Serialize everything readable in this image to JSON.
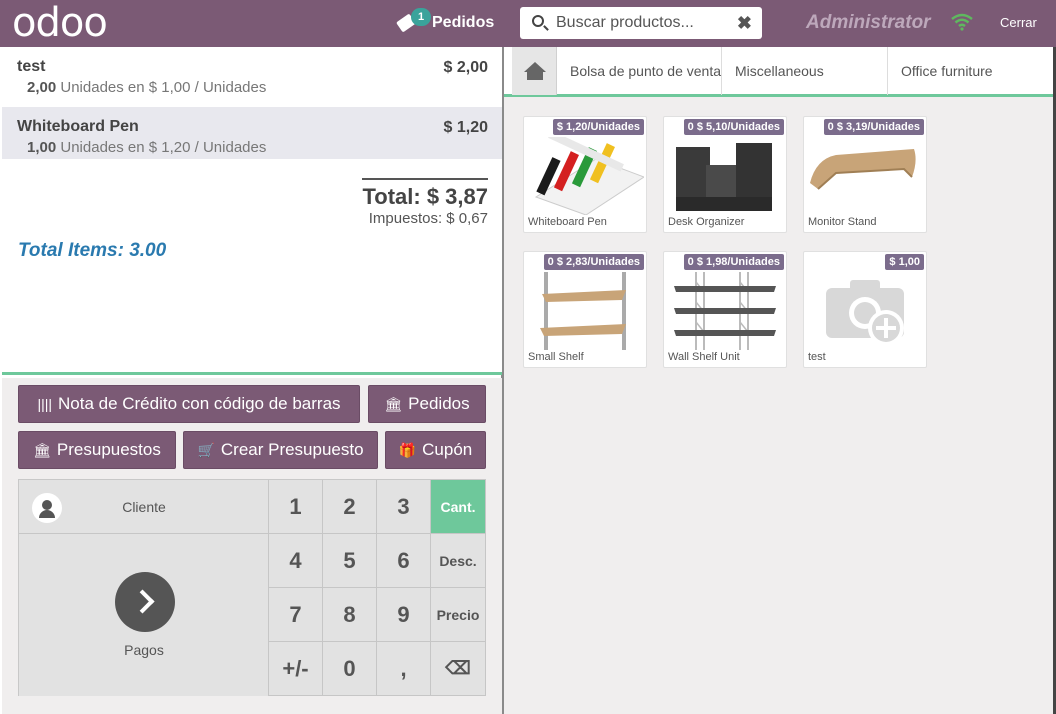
{
  "header": {
    "logo": "odoo",
    "orders_label": "Pedidos",
    "orders_count": "1",
    "search_placeholder": "Buscar productos...",
    "clear_icon": "✖",
    "user": "Administrator",
    "close_label": "Cerrar",
    "colors": {
      "brand": "#7b5a75",
      "badge": "#3aa39b",
      "wifi": "#5fb85f"
    }
  },
  "order": {
    "lines": [
      {
        "name": "test",
        "price": "$ 2,00",
        "qty": "2,00",
        "detail": "Unidades en $ 1,00 / Unidades"
      },
      {
        "name": "Whiteboard Pen",
        "price": "$ 1,20",
        "qty": "1,00",
        "detail": "Unidades en $ 1,20 / Unidades"
      }
    ],
    "total": "Total: $ 3,87",
    "taxes": "Impuestos: $ 0,67",
    "total_items": "Total Items: 3.00"
  },
  "actions": {
    "credit_note": "Nota de Crédito con código de barras",
    "orders": "Pedidos",
    "quotations": "Presupuestos",
    "create_quotation": "Crear Presupuesto",
    "coupon": "Cupón",
    "barcode_icon": "||||",
    "bank_icon": "🏛",
    "cart_icon": "🛒",
    "gift_icon": "🎁"
  },
  "numpad": {
    "client": "Cliente",
    "payment": "Pagos",
    "keys": [
      "1",
      "2",
      "3",
      "4",
      "5",
      "6",
      "7",
      "8",
      "9",
      "+/-",
      "0",
      ","
    ],
    "modes": {
      "qty": "Cant.",
      "disc": "Desc.",
      "price": "Precio"
    },
    "backspace": "⌫",
    "active_mode_color": "#6ec89b"
  },
  "categories": {
    "items": [
      "Bolsa de punto de venta",
      "Miscellaneous",
      "Office furniture"
    ]
  },
  "products": [
    {
      "name": "Whiteboard Pen",
      "tag": "$ 1,20/Unidades"
    },
    {
      "name": "Desk Organizer",
      "tag": "0 $ 5,10/Unidades"
    },
    {
      "name": "Monitor Stand",
      "tag": "0 $ 3,19/Unidades"
    },
    {
      "name": "Small Shelf",
      "tag": "0 $ 2,83/Unidades"
    },
    {
      "name": "Wall Shelf Unit",
      "tag": "0 $ 1,98/Unidades"
    },
    {
      "name": "test",
      "tag": "$ 1,00"
    }
  ]
}
